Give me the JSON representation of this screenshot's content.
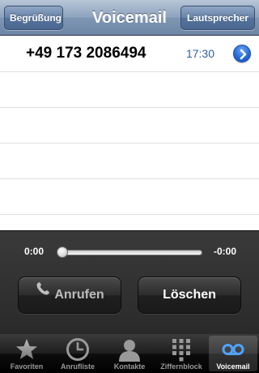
{
  "navbar": {
    "title": "Voicemail",
    "left_button": "Begrüßung",
    "right_button": "Lautsprecher"
  },
  "voicemails": [
    {
      "number": "+49 173 2086494",
      "time": "17:30"
    }
  ],
  "player": {
    "elapsed": "0:00",
    "remaining": "-0:00",
    "progress": 0,
    "call_button": "Anrufen",
    "delete_button": "Löschen"
  },
  "tabs": [
    {
      "label": "Favoriten",
      "icon": "star-icon"
    },
    {
      "label": "Anrufliste",
      "icon": "clock-icon"
    },
    {
      "label": "Kontakte",
      "icon": "contact-icon"
    },
    {
      "label": "Ziffernblock",
      "icon": "keypad-icon"
    },
    {
      "label": "Voicemail",
      "icon": "voicemail-icon",
      "active": true
    }
  ],
  "colors": {
    "navbar": "#7f96b3",
    "time_text": "#2f5fa0",
    "disclosure": "#2367d6",
    "active_tab_icon": "#4fa3ff"
  }
}
